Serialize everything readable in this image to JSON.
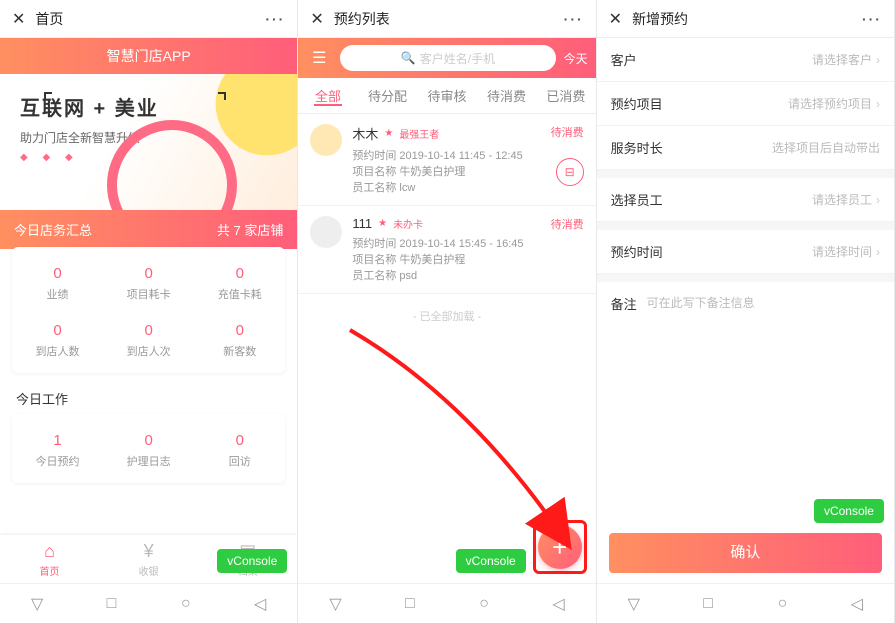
{
  "phone1": {
    "topbar": {
      "title": "首页",
      "dots": "···"
    },
    "appheader": "智慧门店APP",
    "banner": {
      "h2": "互联网  +  美业",
      "p": "助力门店全新智慧升级",
      "dots": "◆ ◆ ◆"
    },
    "summary": {
      "left": "今日店务汇总",
      "right": "共 7 家店铺"
    },
    "stats1": [
      {
        "v": "0",
        "l": "业绩"
      },
      {
        "v": "0",
        "l": "项目耗卡"
      },
      {
        "v": "0",
        "l": "充值卡耗"
      }
    ],
    "stats2": [
      {
        "v": "0",
        "l": "到店人数"
      },
      {
        "v": "0",
        "l": "到店人次"
      },
      {
        "v": "0",
        "l": "新客数"
      }
    ],
    "sectitle": "今日工作",
    "work": [
      {
        "v": "1",
        "l": "今日预约"
      },
      {
        "v": "0",
        "l": "护理日志"
      },
      {
        "v": "0",
        "l": "回访"
      }
    ],
    "tabs": [
      {
        "icon": "⌂",
        "label": "首页"
      },
      {
        "icon": "¥",
        "label": "收银"
      },
      {
        "icon": "▤",
        "label": "档案"
      }
    ],
    "vconsole": "vConsole"
  },
  "phone2": {
    "topbar": {
      "title": "预约列表",
      "dots": "···"
    },
    "search": {
      "placeholder": "客户姓名/手机",
      "today": "今天"
    },
    "tabs": [
      "全部",
      "待分配",
      "待审核",
      "待消费",
      "已消费"
    ],
    "items": [
      {
        "name": "木木",
        "tag": "最强王者",
        "status": "待消费",
        "time": "预约时间 2019-10-14 11:45 - 12:45",
        "proj": "项目名称 牛奶美白护理",
        "emp": "员工名称 lcw"
      },
      {
        "name": "111",
        "tag": "未办卡",
        "status": "待消费",
        "time": "预约时间 2019-10-14 15:45 - 16:45",
        "proj": "项目名称 牛奶美白护程",
        "emp": "员工名称 psd"
      }
    ],
    "loaded": "- 已全部加载 -",
    "vconsole": "vConsole"
  },
  "phone3": {
    "topbar": {
      "title": "新增预约",
      "dots": "···"
    },
    "rows": [
      {
        "label": "客户",
        "value": "请选择客户"
      },
      {
        "label": "预约项目",
        "value": "请选择预约项目"
      },
      {
        "label": "服务时长",
        "value": "选择项目后自动带出"
      },
      {
        "label": "选择员工",
        "value": "请选择员工"
      },
      {
        "label": "预约时间",
        "value": "请选择时间"
      }
    ],
    "remark": {
      "label": "备注",
      "value": "可在此写下备注信息"
    },
    "vconsole": "vConsole",
    "confirm": "确认"
  }
}
